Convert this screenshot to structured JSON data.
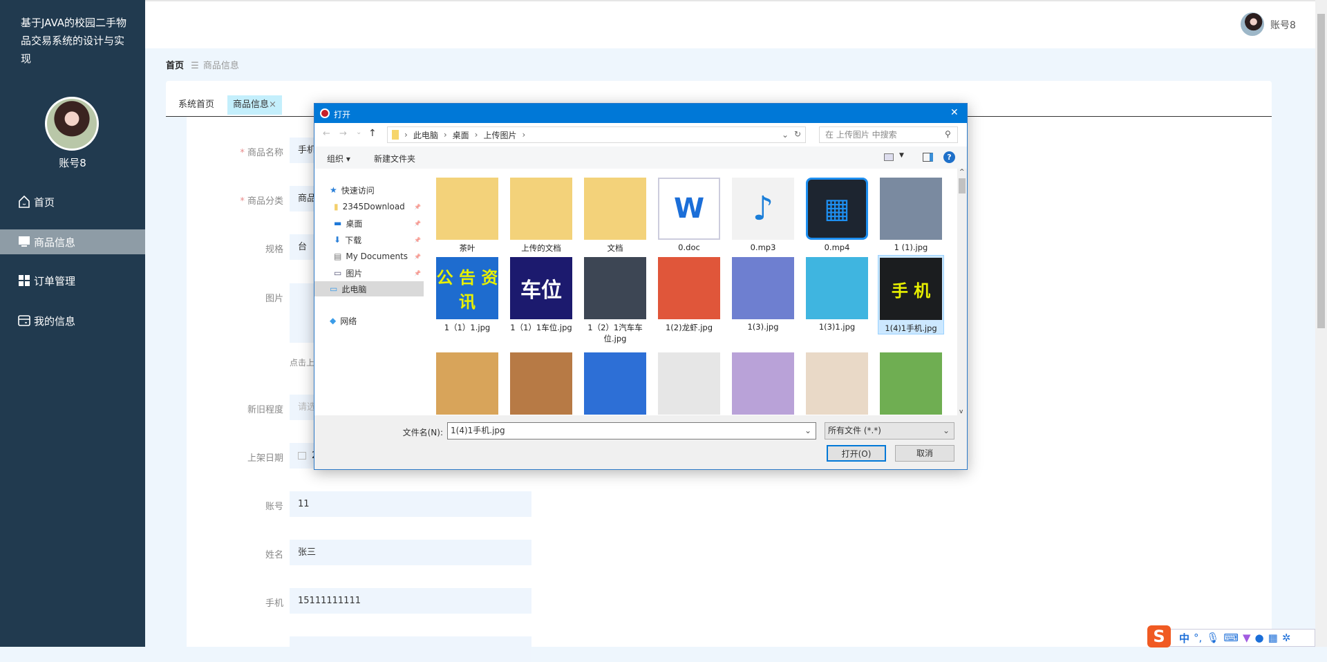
{
  "sidebar": {
    "title": "基于JAVA的校园二手物品交易系统的设计与实现",
    "username": "账号8",
    "menu": [
      {
        "label": "首页",
        "icon": "home-icon"
      },
      {
        "label": "商品信息",
        "icon": "monitor-icon",
        "active": true
      },
      {
        "label": "订单管理",
        "icon": "grid-icon"
      },
      {
        "label": "我的信息",
        "icon": "card-icon"
      }
    ]
  },
  "header": {
    "username": "账号8"
  },
  "breadcrumb": {
    "home": "首页",
    "sep": "☰",
    "current": "商品信息"
  },
  "tabs": [
    {
      "label": "系统首页"
    },
    {
      "label": "商品信息",
      "close": "×"
    }
  ],
  "form": {
    "name": {
      "label": "商品名称",
      "value": "手机"
    },
    "category": {
      "label": "商品分类",
      "value": "商品"
    },
    "spec": {
      "label": "规格",
      "value": "台"
    },
    "image": {
      "label": "图片",
      "hint": "点击上"
    },
    "condition": {
      "label": "新旧程度",
      "placeholder": "请选"
    },
    "date": {
      "label": "上架日期",
      "value": "2"
    },
    "account": {
      "label": "账号",
      "value": "11"
    },
    "realname": {
      "label": "姓名",
      "value": "张三"
    },
    "phone": {
      "label": "手机",
      "value": "15111111111"
    },
    "required_mark": "*"
  },
  "dialog": {
    "title": "打开",
    "close": "✕",
    "path": [
      "此电脑",
      "桌面",
      "上传图片"
    ],
    "search_placeholder": "在 上传图片 中搜索",
    "organize": "组织 ▾",
    "new_folder": "新建文件夹",
    "nav": [
      {
        "label": "快速访问",
        "icon": "star-icon"
      },
      {
        "label": "2345Download",
        "icon": "folder-icon"
      },
      {
        "label": "桌面",
        "icon": "desktop-icon"
      },
      {
        "label": "下载",
        "icon": "download-icon"
      },
      {
        "label": "My Documents",
        "icon": "document-icon"
      },
      {
        "label": "图片",
        "icon": "pictures-icon"
      },
      {
        "label": "此电脑",
        "icon": "computer-icon",
        "selected": true
      },
      {
        "label": "网络",
        "icon": "network-icon"
      }
    ],
    "files": [
      {
        "name": "茶叶",
        "bg": "#f3d27a",
        "glyph": ""
      },
      {
        "name": "上传的文档",
        "bg": "#f3d27a",
        "glyph": ""
      },
      {
        "name": "文档",
        "bg": "#f3d27a",
        "glyph": ""
      },
      {
        "name": "0.doc",
        "bg": "#ffffff",
        "glyph": "W"
      },
      {
        "name": "0.mp3",
        "bg": "#f2f2f2",
        "glyph": "♪"
      },
      {
        "name": "0.mp4",
        "bg": "#1d2530",
        "glyph": "▦"
      },
      {
        "name": "1 (1).jpg",
        "bg": "#7a8aa0",
        "glyph": ""
      },
      {
        "name": "1（1）1.jpg",
        "bg": "#1e6ccf",
        "glyph": "公 告 资 讯"
      },
      {
        "name": "1（1）1车位.jpg",
        "bg": "#1c1a6e",
        "glyph": "车位"
      },
      {
        "name": "1（2）1汽车车位.jpg",
        "bg": "#3d4654",
        "glyph": ""
      },
      {
        "name": "1(2)龙虾.jpg",
        "bg": "#e0563a",
        "glyph": ""
      },
      {
        "name": "1(3).jpg",
        "bg": "#6e7fd0",
        "glyph": ""
      },
      {
        "name": "1(3)1.jpg",
        "bg": "#3fb5e0",
        "glyph": ""
      },
      {
        "name": "1(4)1手机.jpg",
        "bg": "#1b1d1f",
        "glyph": "手 机",
        "selected": true
      },
      {
        "name": "",
        "bg": "#d8a45a",
        "glyph": ""
      },
      {
        "name": "",
        "bg": "#b77a45",
        "glyph": ""
      },
      {
        "name": "",
        "bg": "#2d6fd6",
        "glyph": ""
      },
      {
        "name": "",
        "bg": "#e6e6e6",
        "glyph": ""
      },
      {
        "name": "",
        "bg": "#b9a2d8",
        "glyph": ""
      },
      {
        "name": "",
        "bg": "#e9d9c7",
        "glyph": ""
      },
      {
        "name": "",
        "bg": "#6fae52",
        "glyph": ""
      }
    ],
    "filename_label": "文件名(N):",
    "filename_value": "1(4)1手机.jpg",
    "filetype": "所有文件 (*.*)",
    "open_button": "打开(O)",
    "cancel_button": "取消"
  },
  "ime": {
    "mode": "中",
    "punct": "°,"
  }
}
